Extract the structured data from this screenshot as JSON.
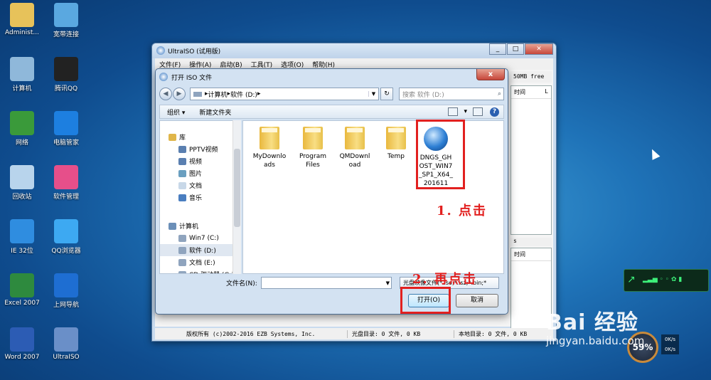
{
  "desktop": {
    "icons": [
      {
        "label": "Administ...",
        "icon": "user-folder-icon",
        "color": "#e7c25a"
      },
      {
        "label": "宽带连接",
        "icon": "network-connection-icon",
        "color": "#5aa8e0"
      },
      {
        "label": "计算机",
        "icon": "computer-icon",
        "color": "#8fb8da"
      },
      {
        "label": "腾讯QQ",
        "icon": "qq-penguin-icon",
        "color": "#222222"
      },
      {
        "label": "网络",
        "icon": "network-globe-icon",
        "color": "#3a9a3a"
      },
      {
        "label": "电脑管家",
        "icon": "shield-icon",
        "color": "#1d7fe0"
      },
      {
        "label": "回收站",
        "icon": "recycle-bin-icon",
        "color": "#b8d4ec"
      },
      {
        "label": "软件管理",
        "icon": "software-manager-icon",
        "color": "#e64f8a"
      },
      {
        "label": "IE 32位",
        "icon": "internet-explorer-icon",
        "color": "#2f8de0"
      },
      {
        "label": "QQ浏览器",
        "icon": "qq-browser-icon",
        "color": "#3da9f2"
      },
      {
        "label": "Excel 2007",
        "icon": "excel-icon",
        "color": "#2e8a3e"
      },
      {
        "label": "上网导航",
        "icon": "web-nav-icon",
        "color": "#1e6ed2"
      },
      {
        "label": "Word 2007",
        "icon": "word-icon",
        "color": "#2c5cb4"
      },
      {
        "label": "UltraISO",
        "icon": "ultraiso-disc-icon",
        "color": "#6a8fc8"
      }
    ]
  },
  "main_window": {
    "title": "UltraISO (试用版)",
    "menu": [
      "文件(F)",
      "操作(A)",
      "启动(B)",
      "工具(T)",
      "选项(O)",
      "帮助(H)"
    ],
    "free_space": "50MB free",
    "col_time_1": "时间",
    "col_l": "L",
    "col_s": "s",
    "col_time_2": "时间",
    "status_copyright": "版权所有 (c)2002-2016 EZB Systems, Inc.",
    "status_disc": "光盘目录: 0 文件, 0 KB",
    "status_local": "本地目录: 0 文件, 0 KB"
  },
  "dialog": {
    "title": "打开 ISO 文件",
    "close": "x",
    "breadcrumb": [
      "计算机",
      "软件 (D:)"
    ],
    "search_placeholder": "搜索 软件 (D:)",
    "toolbar": {
      "organize": "组织 ▾",
      "new_folder": "新建文件夹"
    },
    "nav_items": [
      {
        "label": "库",
        "level": 0,
        "icon": "library-icon",
        "color": "#e0b64a"
      },
      {
        "label": "PPTV视频",
        "level": 1,
        "icon": "video-folder-icon",
        "color": "#5a7fb0"
      },
      {
        "label": "视频",
        "level": 1,
        "icon": "video-icon",
        "color": "#5a7fb0"
      },
      {
        "label": "图片",
        "level": 1,
        "icon": "pictures-icon",
        "color": "#6a9fc0"
      },
      {
        "label": "文档",
        "level": 1,
        "icon": "documents-icon",
        "color": "#c8d8e8"
      },
      {
        "label": "音乐",
        "level": 1,
        "icon": "music-icon",
        "color": "#4a7ec0"
      },
      {
        "label": "",
        "level": 1,
        "icon": "",
        "color": ""
      },
      {
        "label": "计算机",
        "level": 0,
        "icon": "computer-icon",
        "color": "#6b8fb8"
      },
      {
        "label": "Win7 (C:)",
        "level": 1,
        "icon": "drive-icon",
        "color": "#8fa4be"
      },
      {
        "label": "软件 (D:)",
        "level": 1,
        "icon": "drive-icon",
        "color": "#8fa4be",
        "selected": true
      },
      {
        "label": "文档 (E:)",
        "level": 1,
        "icon": "drive-icon",
        "color": "#8fa4be"
      },
      {
        "label": "CD 驱动器 (G:)",
        "level": 1,
        "icon": "cd-drive-icon",
        "color": "#8fa4be"
      }
    ],
    "files": [
      {
        "name": "MyDownloads",
        "label": "MyDownlo\nads",
        "type": "folder"
      },
      {
        "name": "Program Files",
        "label": "Program\nFiles",
        "type": "folder"
      },
      {
        "name": "QMDownload",
        "label": "QMDownl\noad",
        "type": "folder"
      },
      {
        "name": "Temp",
        "label": "Temp",
        "type": "folder"
      },
      {
        "name": "DNGS_GHOST_WIN7_SP1_X64_201611",
        "label": "DNGS_GH\nOST_WIN7\n_SP1_X64_\n201611",
        "type": "iso"
      }
    ],
    "filename_label": "文件名(N):",
    "filename_value": "",
    "filetype_value": "光盘映像文件(*.iso;*.isz;*.bin;*",
    "open_button": "打开(O)",
    "cancel_button": "取消"
  },
  "annotations": {
    "step1": "1. 点击",
    "step2": "2. 再点击",
    "highlight_color": "#e2201f"
  },
  "widgets": {
    "speed_percent": "59%",
    "upload": "0K/s",
    "download": "0K/s"
  },
  "watermark": {
    "brand": "Bai 经验",
    "url": "jingyan.baidu.com"
  }
}
